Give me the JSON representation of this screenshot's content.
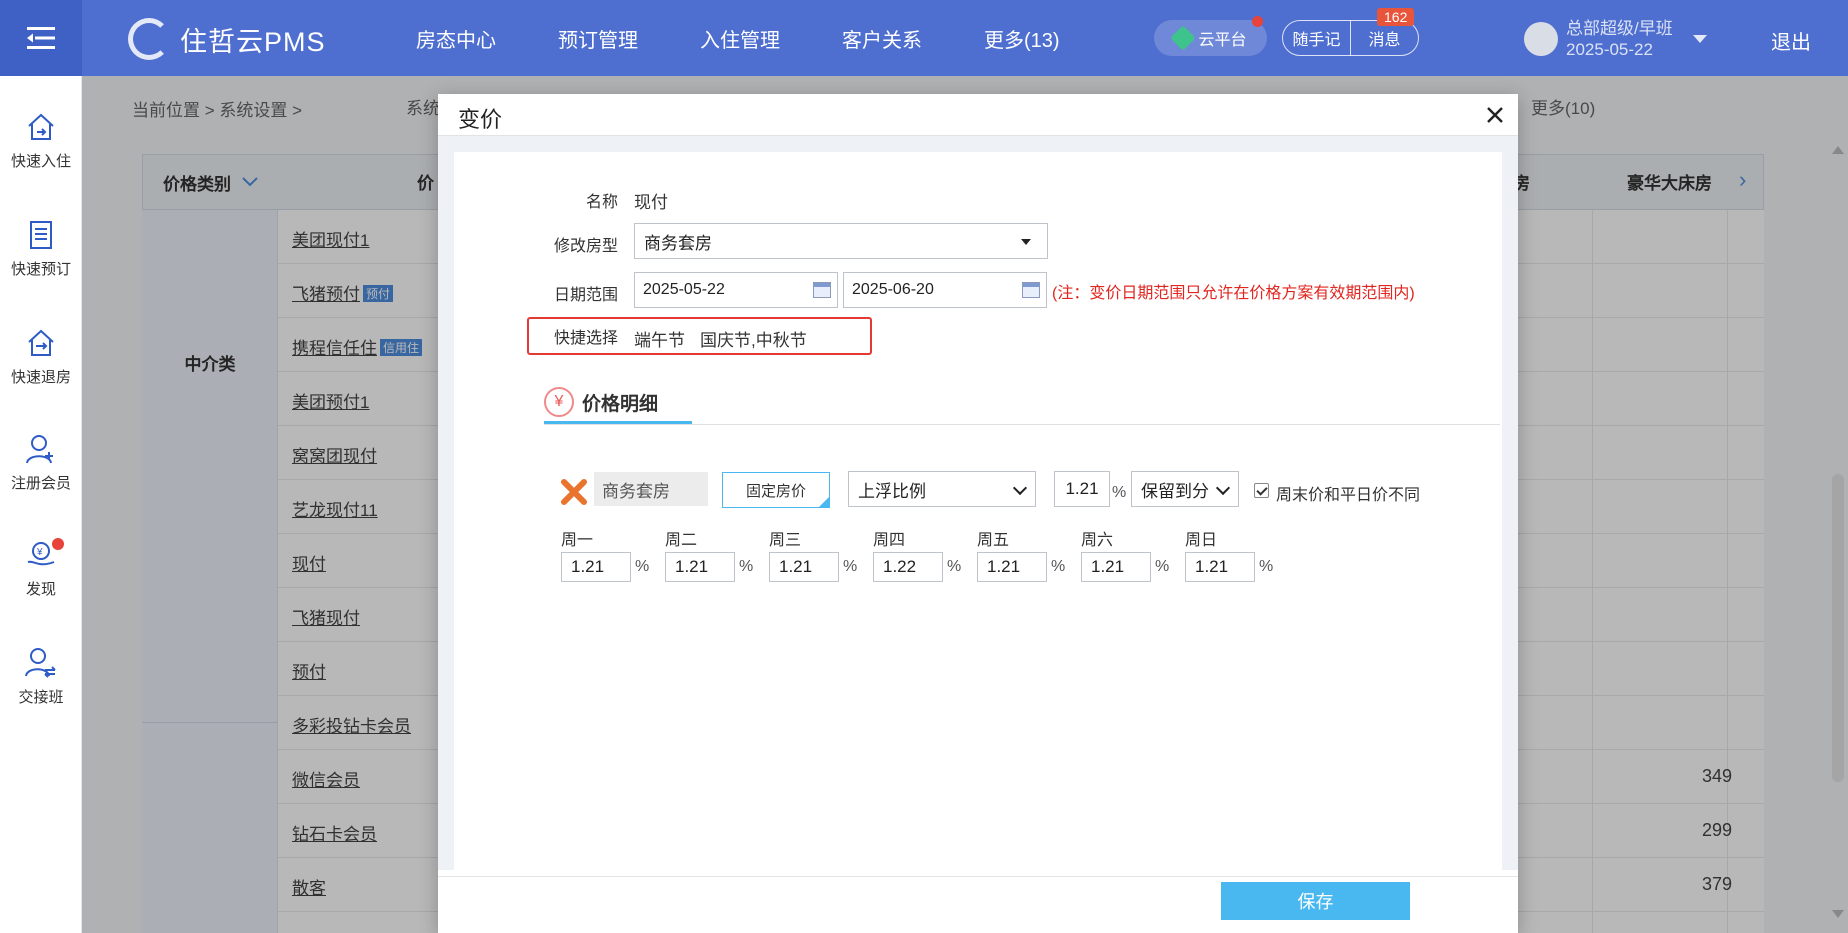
{
  "topbar": {
    "app_name": "住哲云PMS",
    "nav": [
      "房态中心",
      "预订管理",
      "入住管理",
      "客户关系",
      "更多(13)"
    ],
    "cloud_platform": "云平台",
    "notes": "随手记",
    "messages": "消息",
    "message_count": "162",
    "user_role": "总部超级/早班",
    "user_date": "2025-05-22",
    "logout": "退出"
  },
  "sidebar": {
    "items": [
      "快速入住",
      "快速预订",
      "快速退房",
      "注册会员",
      "发现",
      "交接班"
    ]
  },
  "background": {
    "breadcrumb": "当前位置 > 系统设置 >",
    "tab_partial": "系统",
    "more_tabs": "更多(10)",
    "header_category": "价格类别",
    "header_price": "价",
    "header_room_partial": "房",
    "header_luxury": "豪华大床房",
    "category_agency": "中介类",
    "rows": [
      {
        "name": "美团现付1",
        "tag": "",
        "price": ""
      },
      {
        "name": "飞猪预付",
        "tag": "预付",
        "price": ""
      },
      {
        "name": "携程信任住",
        "tag": "信用住",
        "price": ""
      },
      {
        "name": "美团预付1",
        "tag": "",
        "price": ""
      },
      {
        "name": "窝窝团现付",
        "tag": "",
        "price": ""
      },
      {
        "name": "艺龙现付11",
        "tag": "",
        "price": ""
      },
      {
        "name": "现付",
        "tag": "",
        "price": ""
      },
      {
        "name": "飞猪现付",
        "tag": "",
        "price": ""
      },
      {
        "name": "预付",
        "tag": "",
        "price": ""
      },
      {
        "name": "多彩投钻卡会员",
        "tag": "",
        "price": ""
      },
      {
        "name": "微信会员",
        "tag": "",
        "price": "349"
      },
      {
        "name": "钻石卡会员",
        "tag": "",
        "price": "299"
      },
      {
        "name": "散客",
        "tag": "",
        "price": "379"
      }
    ]
  },
  "modal": {
    "title": "变价",
    "name_label": "名称",
    "name_value": "现付",
    "room_type_label": "修改房型",
    "room_type_value": "商务套房",
    "date_range_label": "日期范围",
    "date_start": "2025-05-22",
    "date_end": "2025-06-20",
    "date_note": "(注：变价日期范围只允许在价格方案有效期范围内)",
    "quick_label": "快捷选择",
    "quick_options": [
      "端午节",
      "国庆节,中秋节"
    ],
    "tab_label": "价格明细",
    "detail": {
      "room": "商务套房",
      "fixed_price_btn": "固定房价",
      "mode": "上浮比例",
      "ratio": "1.21",
      "percent": "%",
      "rounding": "保留到分",
      "weekend_diff_label": "周末价和平日价不同",
      "weekend_diff_checked": true,
      "days": [
        {
          "label": "周一",
          "value": "1.21"
        },
        {
          "label": "周二",
          "value": "1.21"
        },
        {
          "label": "周三",
          "value": "1.21"
        },
        {
          "label": "周四",
          "value": "1.22"
        },
        {
          "label": "周五",
          "value": "1.21"
        },
        {
          "label": "周六",
          "value": "1.21"
        },
        {
          "label": "周日",
          "value": "1.21"
        }
      ]
    },
    "save": "保存"
  }
}
